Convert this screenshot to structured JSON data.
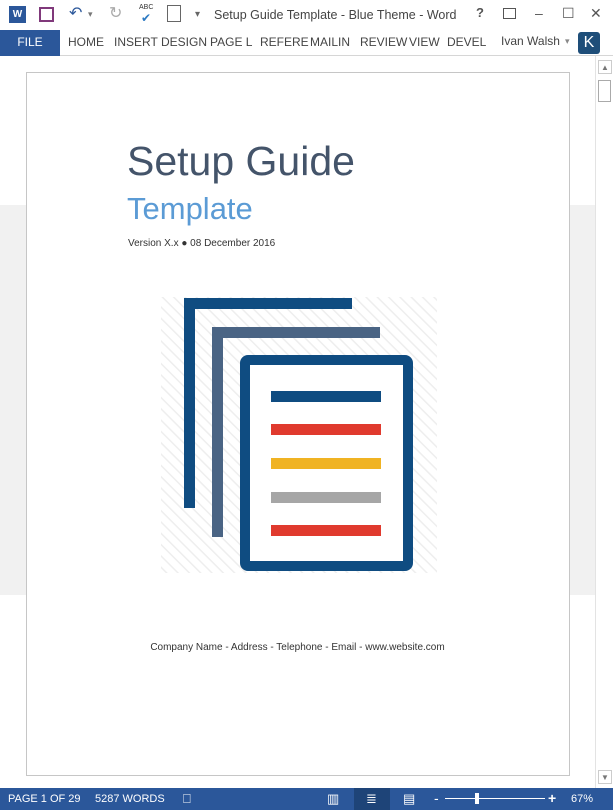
{
  "window": {
    "title": "Setup Guide Template - Blue Theme - Word",
    "help": "?",
    "minimize": "–",
    "maximize": "☐",
    "close": "✕"
  },
  "quick_access": {
    "word_icon": "W",
    "save": "💾",
    "undo": "↶",
    "redo": "↻",
    "spelling": "ABC",
    "customize": "▾"
  },
  "ribbon": {
    "file": "FILE",
    "tabs": [
      "HOME",
      "INSERT",
      "DESIGN",
      "PAGE L",
      "REFERE",
      "MAILIN",
      "REVIEW",
      "VIEW",
      "DEVEL"
    ],
    "user": "Ivan Walsh",
    "user_caret": "▾",
    "avatar": "K"
  },
  "document": {
    "title": "Setup Guide",
    "subtitle": "Template",
    "version": "Version X.x ● 08 December 2016",
    "footer": "Company Name - Address - Telephone - Email - www.website.com"
  },
  "colors": {
    "accent": "#2b579a",
    "title": "#44546a",
    "subtitle": "#5b9bd5",
    "dark_blue": "#0f4c81",
    "slate": "#4a6484",
    "red": "#e03a2e",
    "yellow": "#f0b323",
    "grey": "#a6a6a6"
  },
  "status": {
    "page": "PAGE 1 OF 29",
    "words": "5287 WORDS",
    "zoom": "67%",
    "zoom_minus": "-",
    "zoom_plus": "+",
    "zoom_level_percent": 67
  }
}
